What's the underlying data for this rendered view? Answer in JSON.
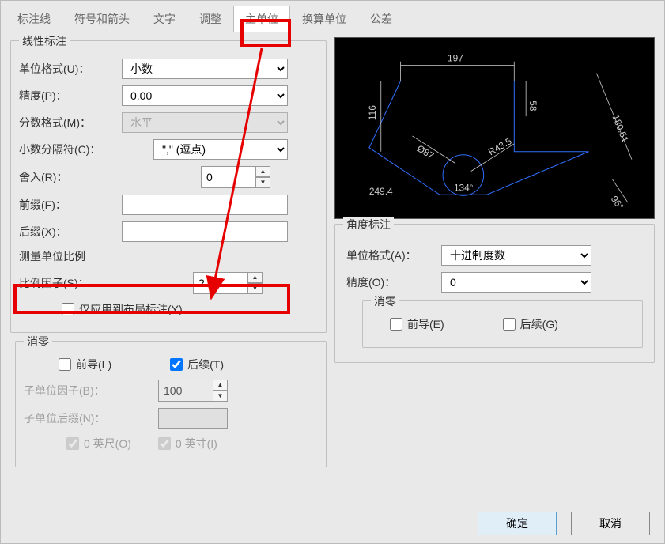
{
  "tabs": {
    "t1": "标注线",
    "t2": "符号和箭头",
    "t3": "文字",
    "t4": "调整",
    "t5": "主单位",
    "t6": "换算单位",
    "t7": "公差"
  },
  "linear": {
    "title": "线性标注",
    "unit_format_label": "单位格式(U)：",
    "unit_format_value": "小数",
    "precision_label": "精度(P)：",
    "precision_value": "0.00",
    "fraction_label": "分数格式(M)：",
    "fraction_value": "水平",
    "separator_label": "小数分隔符(C)：",
    "separator_value": "\",\" (逗点)",
    "roundoff_label": "舍入(R)：",
    "roundoff_value": "0",
    "prefix_label": "前缀(F)：",
    "prefix_value": "",
    "suffix_label": "后缀(X)：",
    "suffix_value": ""
  },
  "scale": {
    "title": "测量单位比例",
    "factor_label": "比例因子(S)：",
    "factor_value": "2",
    "layout_only_label": "仅应用到布局标注(Y)"
  },
  "zero": {
    "title": "消零",
    "leading": "前导(L)",
    "trailing": "后续(T)",
    "subfactor_label": "子单位因子(B)：",
    "subfactor_value": "100",
    "subsuffix_label": "子单位后缀(N)：",
    "feet": "0 英尺(O)",
    "inch": "0 英寸(I)"
  },
  "angular": {
    "title": "角度标注",
    "unit_label": "单位格式(A)：",
    "unit_value": "十进制度数",
    "precision_label": "精度(O)：",
    "precision_value": "0",
    "zero_title": "消零",
    "leading": "前导(E)",
    "trailing": "后续(G)"
  },
  "buttons": {
    "ok": "确定",
    "cancel": "取消"
  },
  "preview": {
    "d1": "197",
    "d2": "58",
    "d3": "116",
    "d4": "180.51",
    "d5": "Ø87",
    "d6": "R43.5",
    "d7": "134°",
    "d8": "249.4",
    "d9": "96°"
  }
}
